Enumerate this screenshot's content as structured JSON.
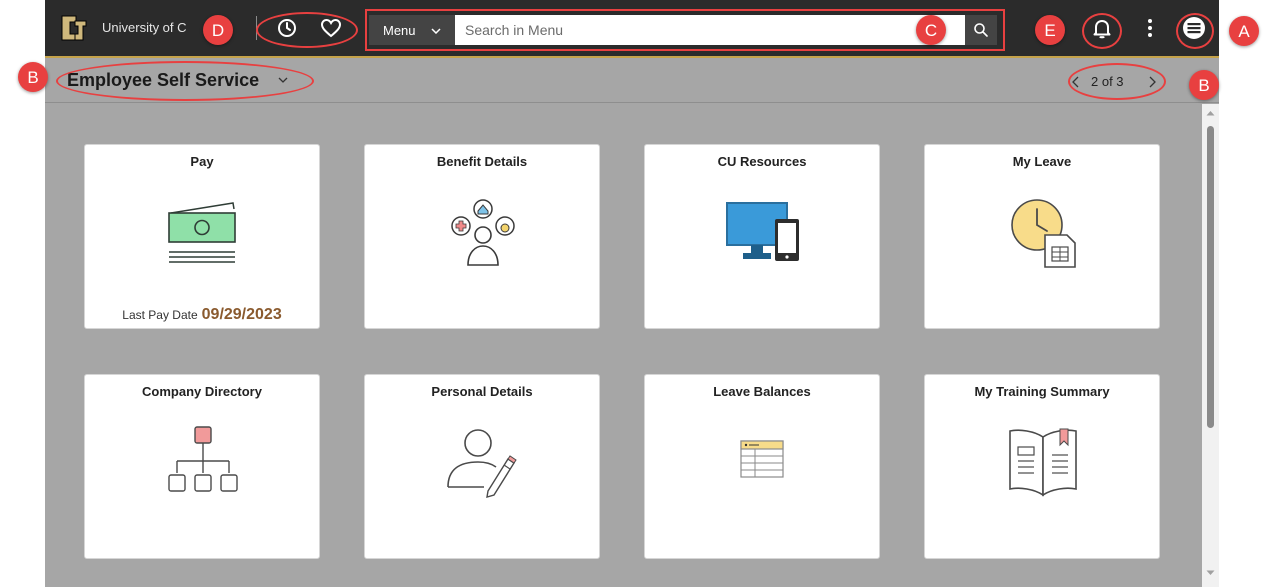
{
  "header": {
    "university_name": "University of C",
    "menu_label": "Menu",
    "search_placeholder": "Search in Menu"
  },
  "subheader": {
    "page_title": "Employee Self Service",
    "pagination": "2 of 3"
  },
  "tiles": [
    {
      "title": "Pay",
      "icon": "money-icon",
      "footer_label": "Last Pay Date",
      "footer_value": "09/29/2023"
    },
    {
      "title": "Benefit Details",
      "icon": "benefits-icon"
    },
    {
      "title": "CU Resources",
      "icon": "devices-icon"
    },
    {
      "title": "My Leave",
      "icon": "clock-document-icon"
    },
    {
      "title": "Company Directory",
      "icon": "org-chart-icon"
    },
    {
      "title": "Personal Details",
      "icon": "person-edit-icon"
    },
    {
      "title": "Leave Balances",
      "icon": "balance-sheet-icon"
    },
    {
      "title": "My Training Summary",
      "icon": "book-icon"
    }
  ],
  "annotations": [
    "A",
    "B",
    "B",
    "C",
    "D",
    "E"
  ],
  "colors": {
    "topbar": "#2b2b2b",
    "page_bg": "#a6a6a6",
    "annotation": "#e84040",
    "pay_date": "#8a5a2e",
    "accent_gold": "#c5a34a"
  }
}
